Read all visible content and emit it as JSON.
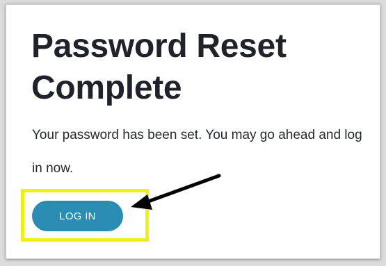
{
  "page": {
    "title": "Password Reset Complete",
    "message": "Your password has been set. You may go ahead and log in now."
  },
  "actions": {
    "login_label": "LOG IN"
  },
  "annotation": {
    "highlight_color": "#f2ef18",
    "arrow_color": "#000000",
    "button_color": "#2b8cb3"
  }
}
